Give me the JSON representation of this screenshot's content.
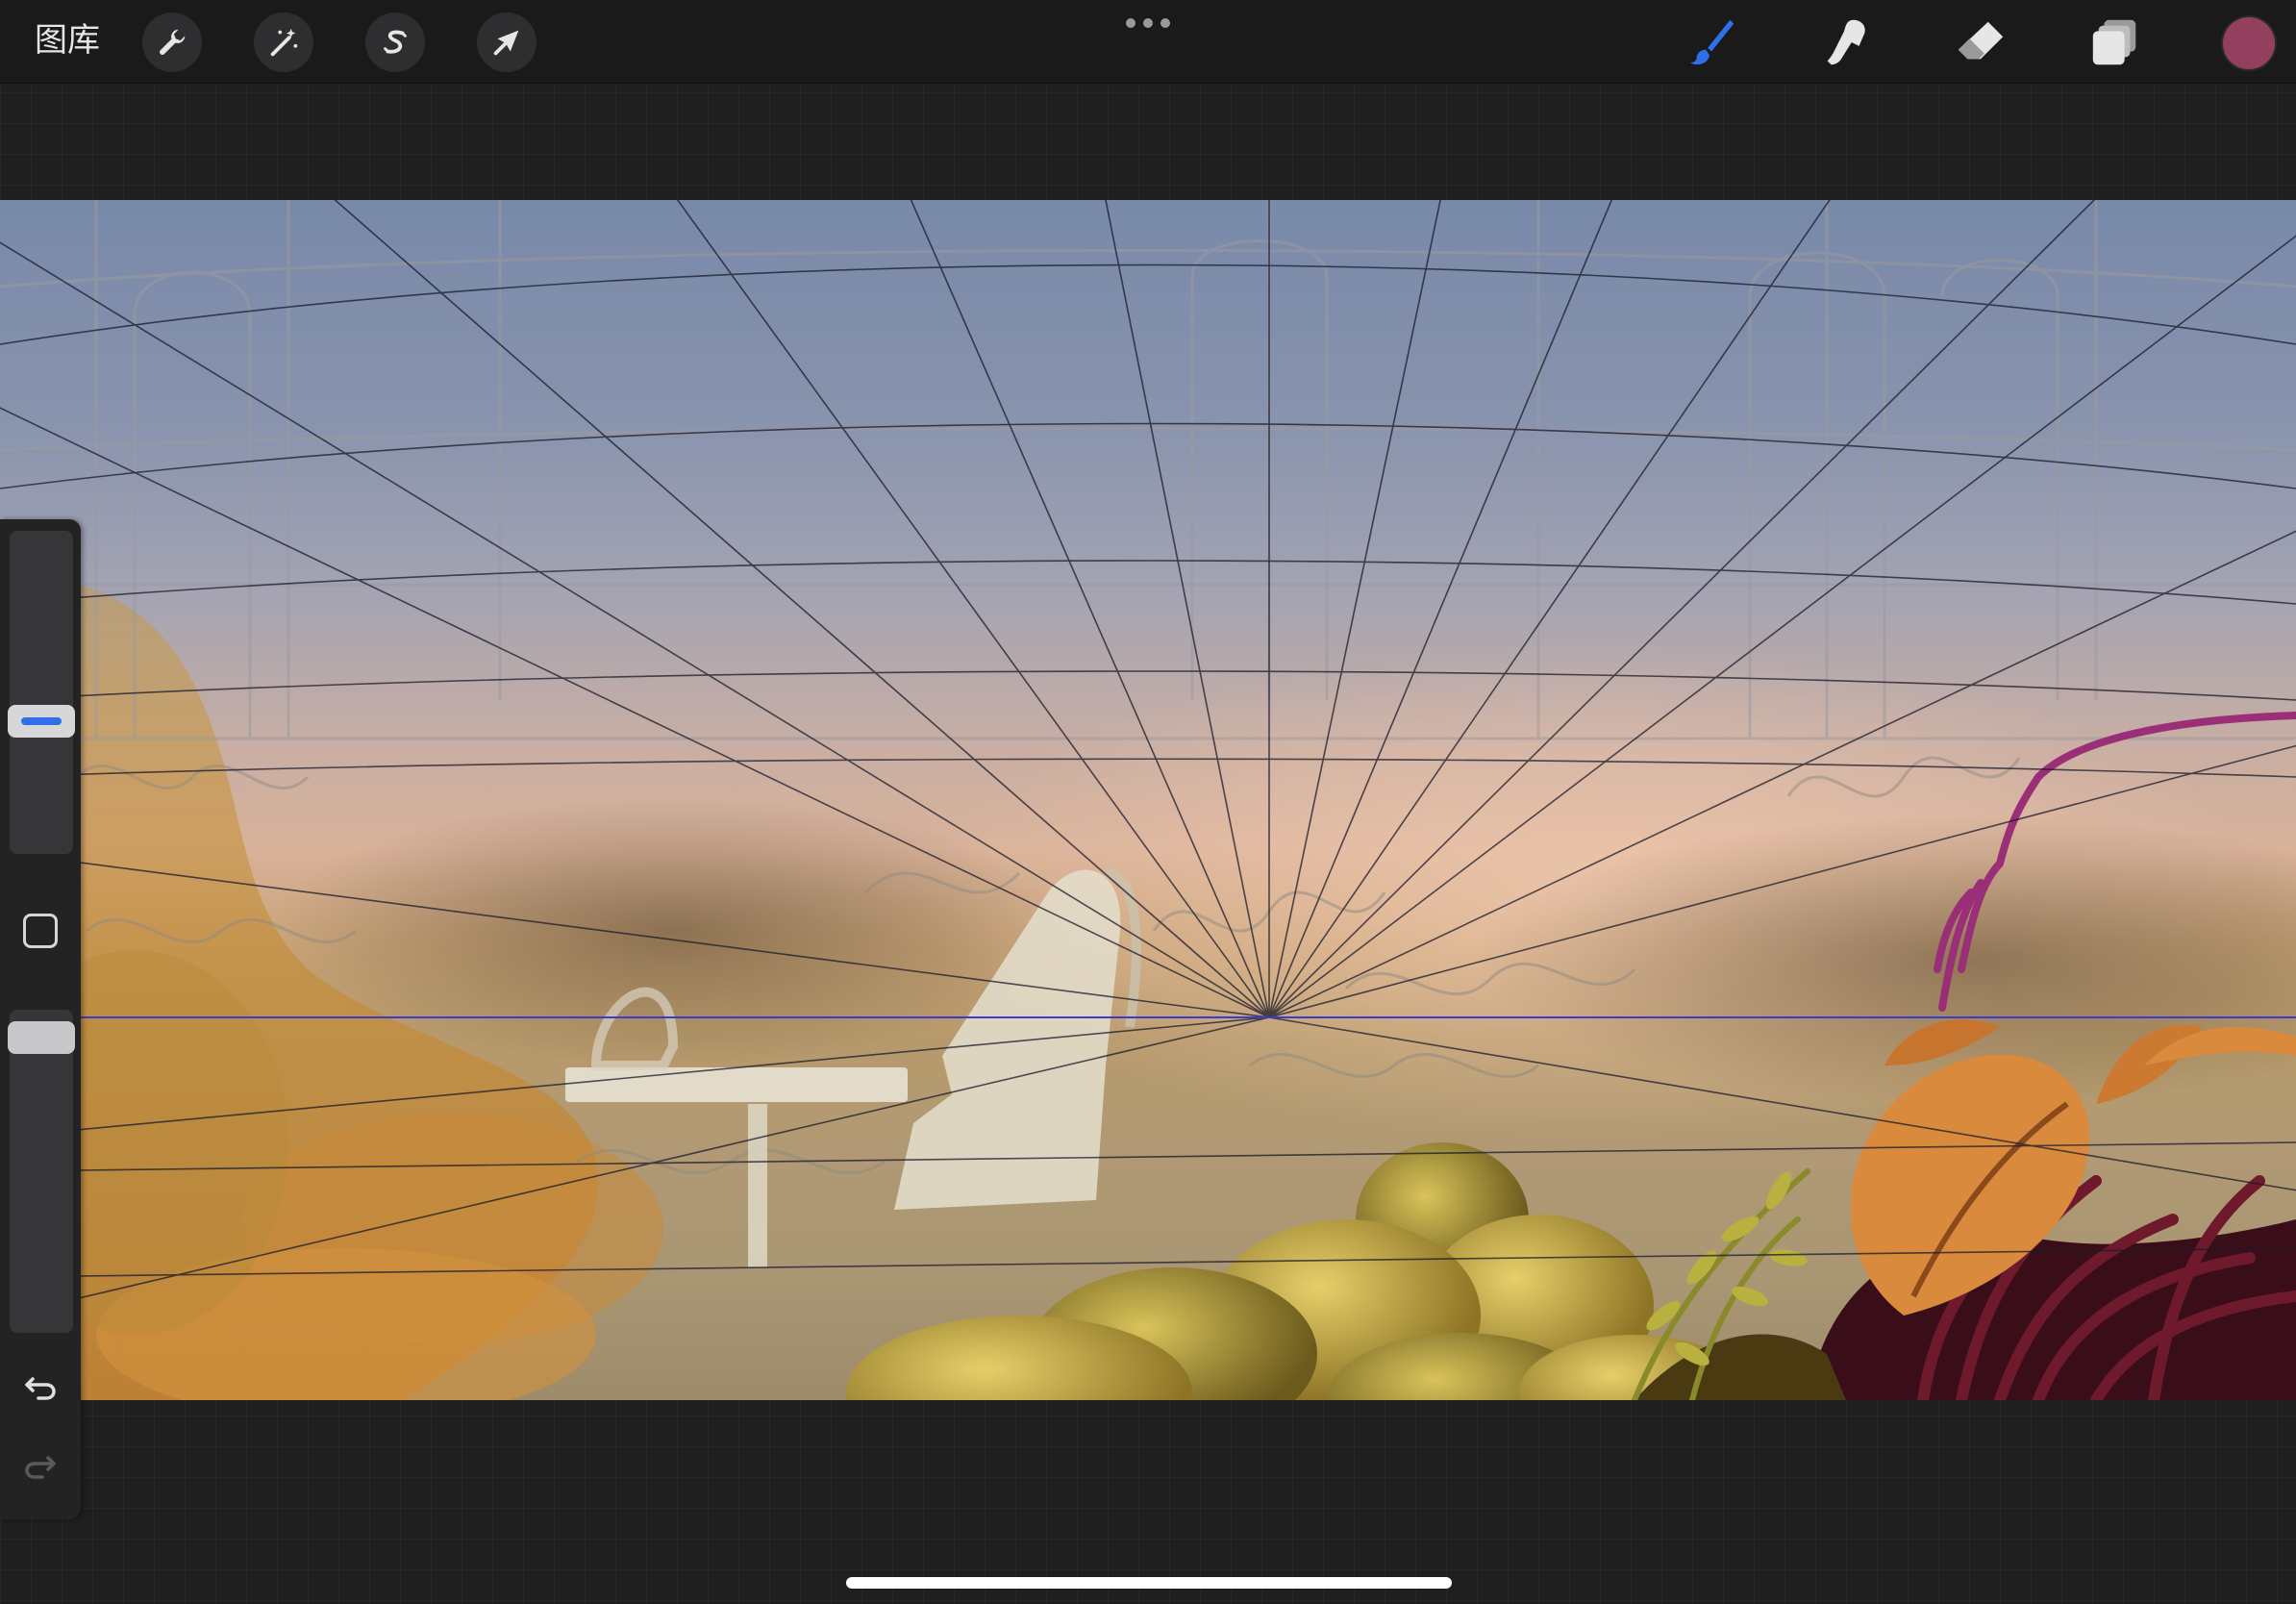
{
  "topbar": {
    "gallery_label": "图库",
    "left_tools": [
      {
        "name": "actions",
        "icon": "wrench-icon"
      },
      {
        "name": "adjustments",
        "icon": "magic-wand-icon"
      },
      {
        "name": "selection",
        "icon": "selection-s-icon"
      },
      {
        "name": "transform",
        "icon": "arrow-cursor-icon"
      }
    ],
    "more_menu_icon": "ellipsis-icon",
    "right_tools": [
      {
        "name": "brush",
        "icon": "paintbrush-icon",
        "active": true
      },
      {
        "name": "smudge",
        "icon": "smudge-finger-icon",
        "active": false
      },
      {
        "name": "eraser",
        "icon": "eraser-icon",
        "active": false
      },
      {
        "name": "layers",
        "icon": "layers-icon",
        "active": false
      }
    ],
    "current_color": "#93405f"
  },
  "sidebar": {
    "size_slider_level": 0.4,
    "opacity_slider_level": 0.96,
    "modify_icon": "square-icon",
    "undo_icon": "undo-arrow-icon",
    "redo_icon": "redo-arrow-icon",
    "redo_enabled": false
  },
  "canvas": {
    "drawing_guide": "perspective-grid",
    "guide_line_color": "#1a1a2a",
    "horizon_color": "#3b3bd0",
    "accent_colors": {
      "brush_active": "#2f6fe8",
      "stroke_magenta": "#9a2f78",
      "foliage_orange": "#d98a3d",
      "fruit_yellow": "#c9a93a",
      "leaf_dark_red": "#5a1424"
    }
  },
  "system": {
    "home_indicator": true
  }
}
